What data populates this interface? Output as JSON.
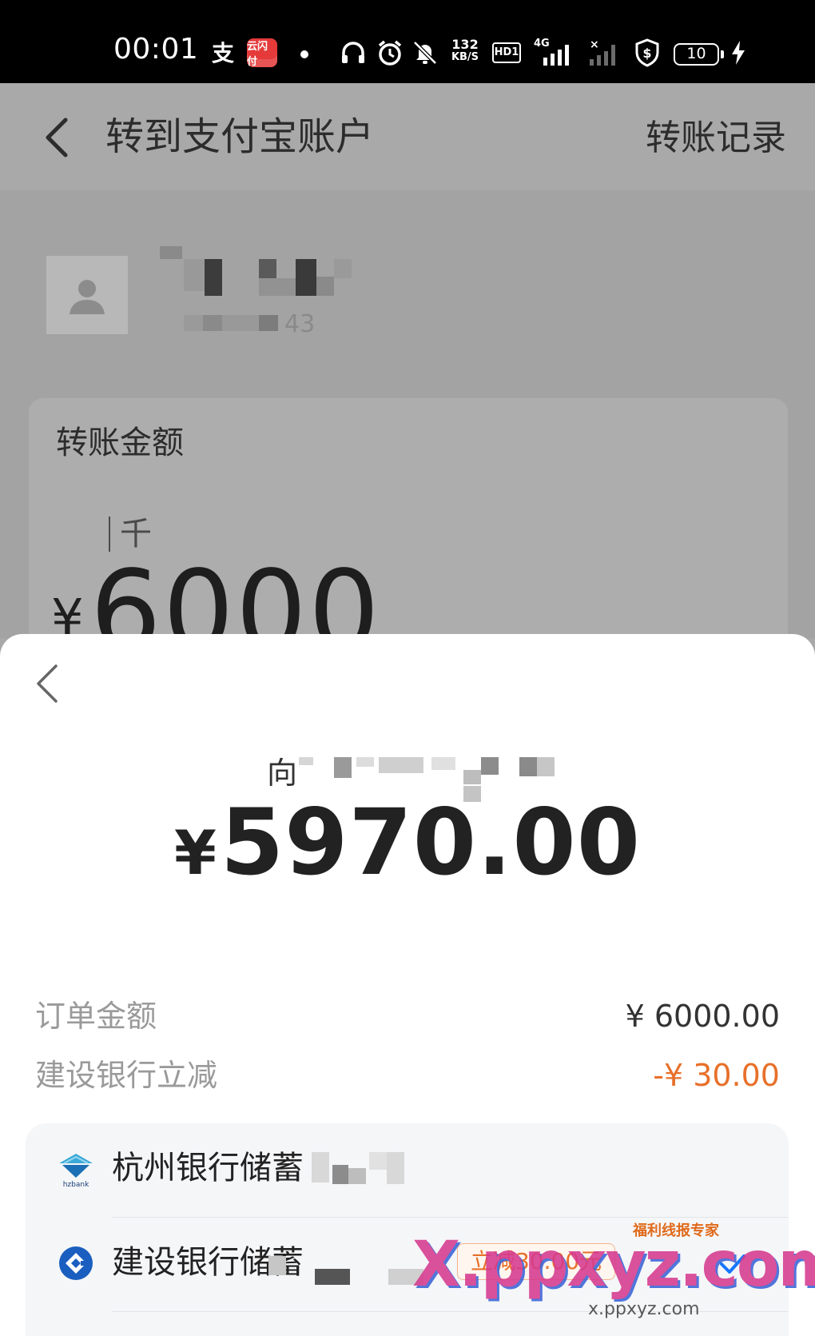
{
  "status_bar": {
    "time": "00:01",
    "alipay_glyph": "支",
    "app_badge": "云闪付",
    "net_speed_value": "132",
    "net_speed_unit": "KB/S",
    "hd_label": "HD1",
    "network_label": "4G",
    "battery_level": "10",
    "icons": [
      "headphones-icon",
      "alarm-icon",
      "mute-bell-icon",
      "signal-icon",
      "shield-dollar-icon",
      "charging-bolt-icon"
    ]
  },
  "background_page": {
    "title": "转到支付宝账户",
    "records_link": "转账记录",
    "amount_label": "转账金额",
    "amount_unit_hint": "千",
    "amount_currency": "¥",
    "amount_value": "6000",
    "contact_suffix": "43"
  },
  "sheet": {
    "payee_prefix": "向",
    "pay_currency": "¥",
    "pay_amount": "5970.00",
    "details": [
      {
        "label": "订单金额",
        "value": "¥ 6000.00"
      },
      {
        "label": "建设银行立减",
        "value": "-¥ 30.00"
      }
    ],
    "banks": [
      {
        "name": "杭州银行储蓄",
        "logo": "hzbank-logo",
        "logo_text": "hzbank"
      },
      {
        "name": "建设银行储蓄",
        "logo": "ccb-logo",
        "tag": "立减30.00元"
      }
    ]
  },
  "watermark": {
    "brand": "X.ppxyz.com",
    "slogan": "福利线报专家",
    "url": "x.ppxyz.com"
  },
  "colors": {
    "discount": "#e8702a",
    "ccb_blue": "#1a5ebf",
    "dim_overlay": "#a8a8a8"
  }
}
